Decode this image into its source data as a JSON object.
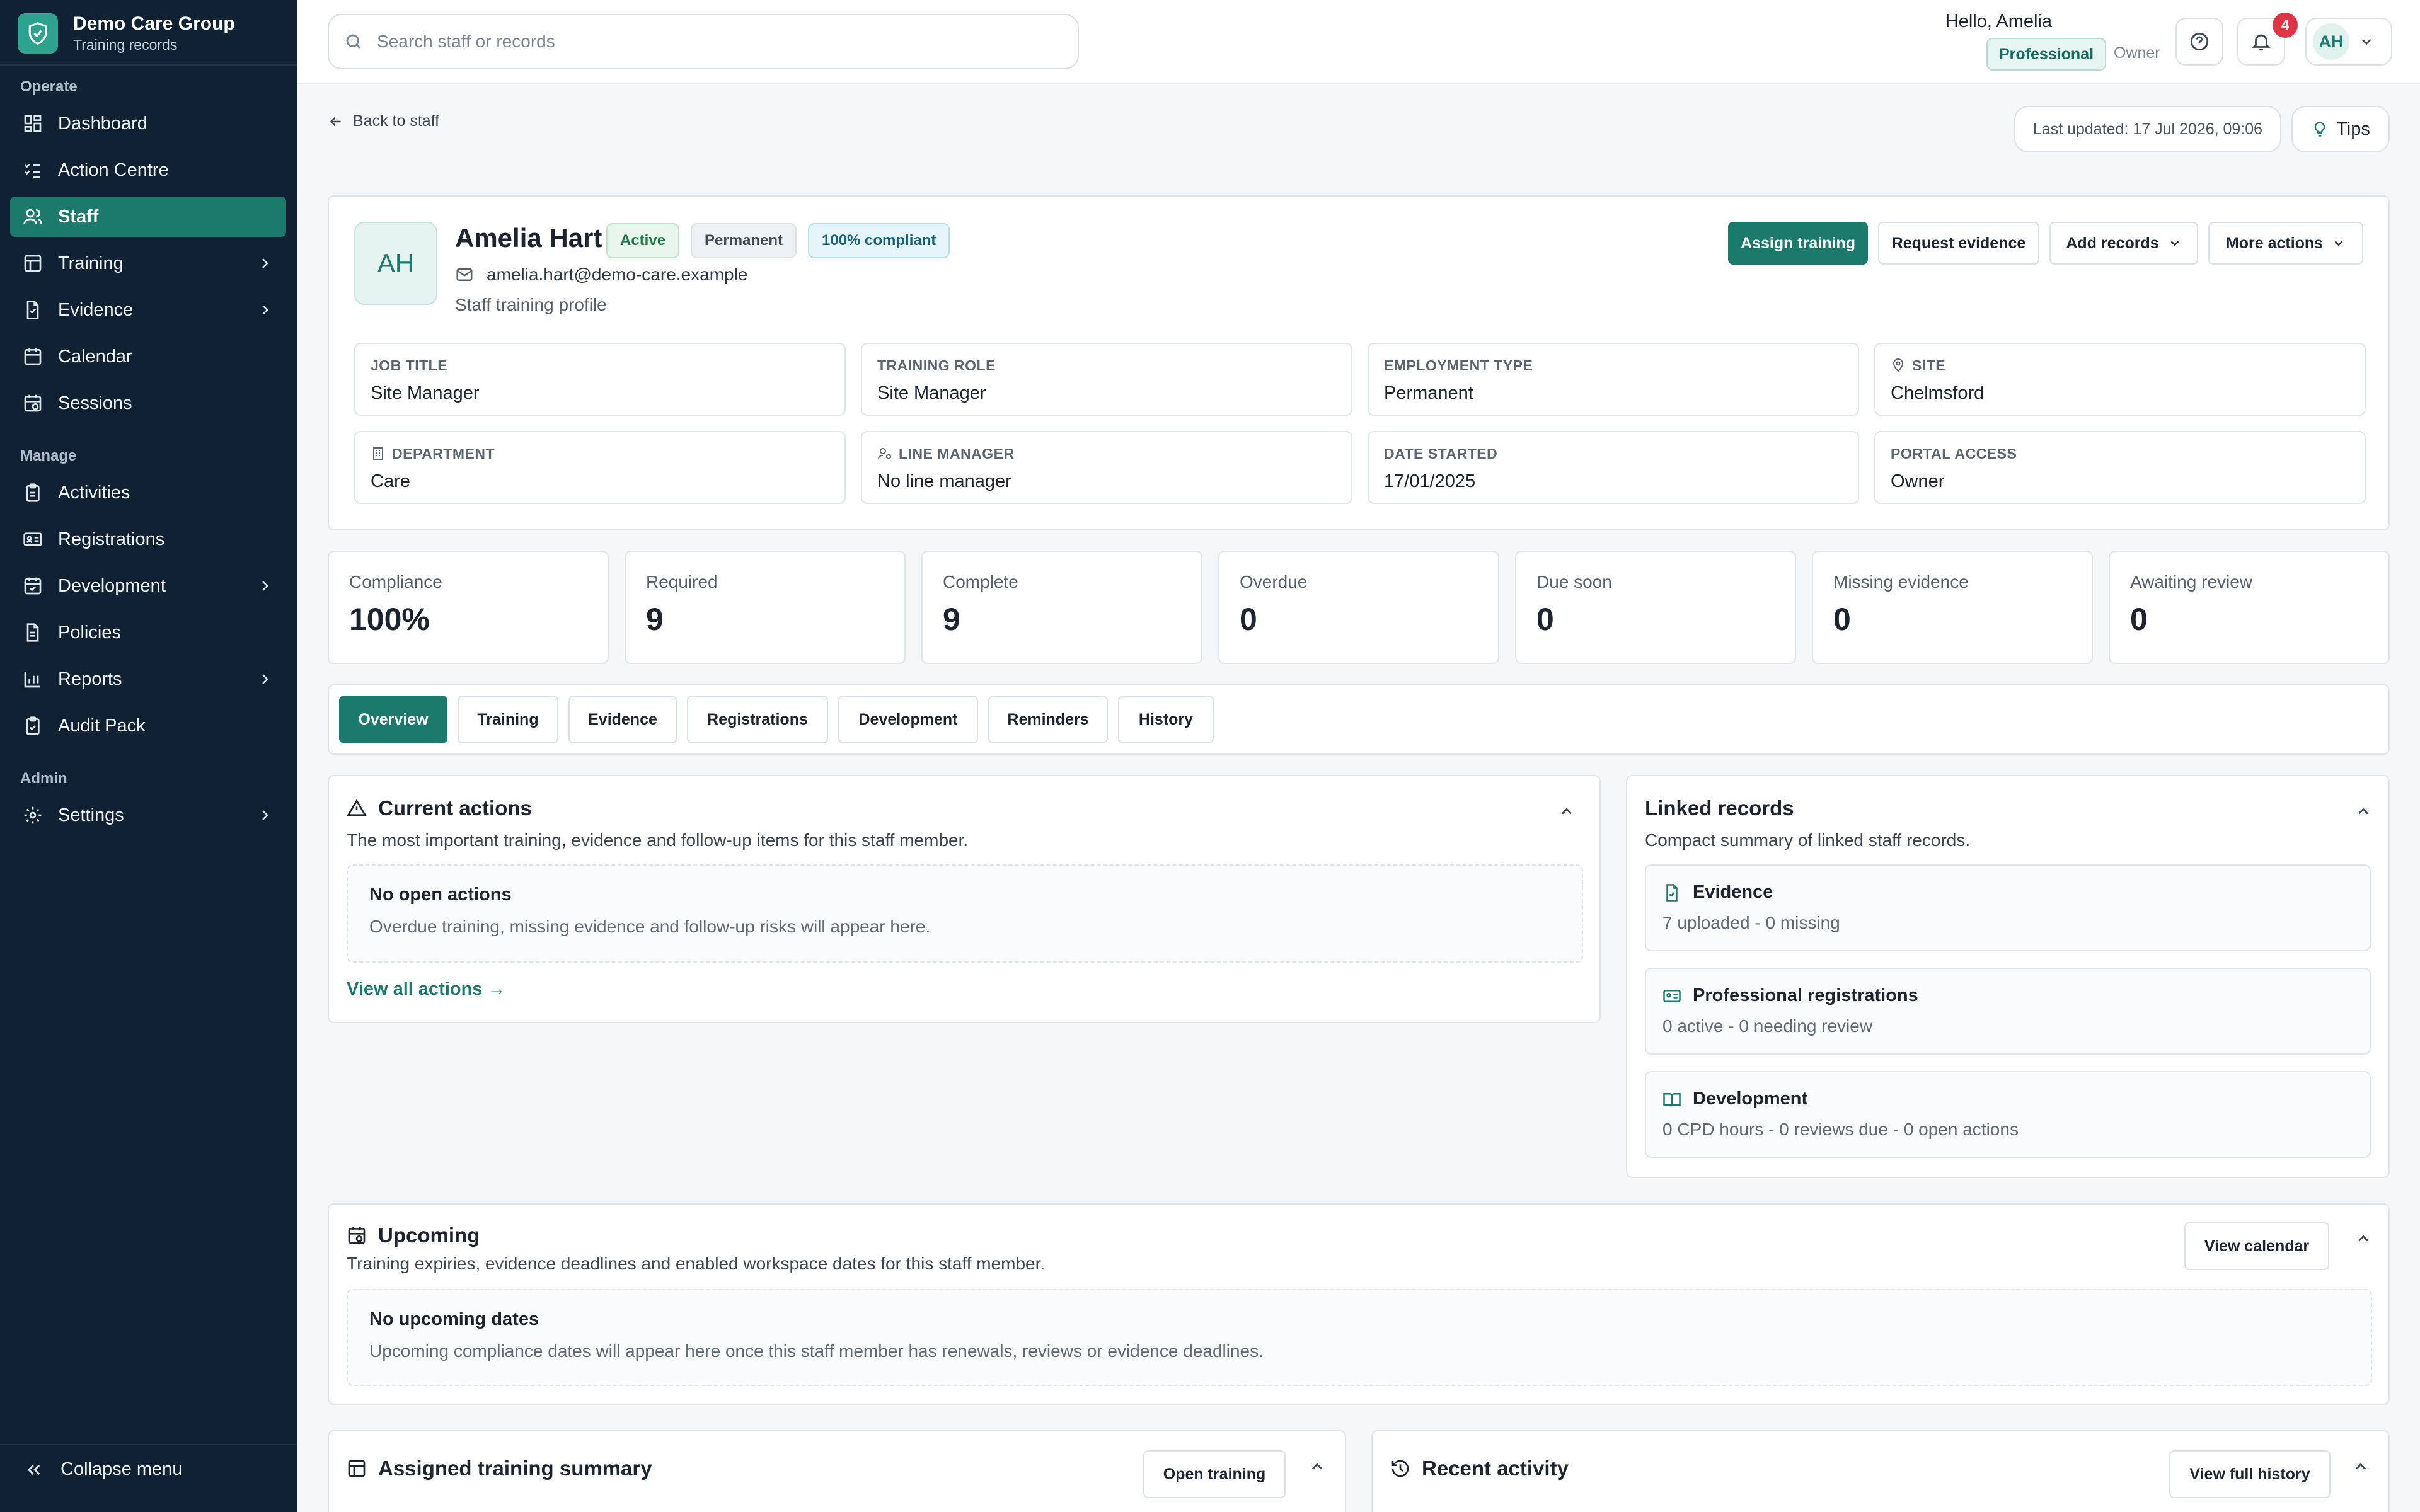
{
  "sidebar": {
    "brand": {
      "name": "Demo Care Group",
      "subtitle": "Training records"
    },
    "sections": [
      {
        "label": "Operate",
        "items": [
          {
            "label": "Dashboard",
            "icon": "dashboard-icon"
          },
          {
            "label": "Action Centre",
            "icon": "list-checks-icon"
          },
          {
            "label": "Staff",
            "icon": "users-icon",
            "active": true
          },
          {
            "label": "Training",
            "icon": "table-icon",
            "expandable": true
          },
          {
            "label": "Evidence",
            "icon": "file-icon",
            "expandable": true
          },
          {
            "label": "Calendar",
            "icon": "calendar-icon"
          },
          {
            "label": "Sessions",
            "icon": "calendar-clock-icon"
          }
        ]
      },
      {
        "label": "Manage",
        "items": [
          {
            "label": "Activities",
            "icon": "clipboard-icon"
          },
          {
            "label": "Registrations",
            "icon": "id-card-icon"
          },
          {
            "label": "Development",
            "icon": "calendar-check-icon",
            "expandable": true
          },
          {
            "label": "Policies",
            "icon": "document-icon"
          },
          {
            "label": "Reports",
            "icon": "bar-chart-icon",
            "expandable": true
          },
          {
            "label": "Audit Pack",
            "icon": "clipboard-check-icon"
          }
        ]
      },
      {
        "label": "Admin",
        "items": [
          {
            "label": "Settings",
            "icon": "gear-icon",
            "expandable": true
          }
        ]
      }
    ],
    "collapse_label": "Collapse menu"
  },
  "topbar": {
    "search_placeholder": "Search staff or records",
    "greeting": "Hello, Amelia",
    "plan": "Professional",
    "role": "Owner",
    "notification_count": "4",
    "avatar_initials": "AH"
  },
  "page": {
    "back_label": "Back to staff",
    "last_updated": "Last updated: 17 Jul 2026, 09:06",
    "tips_label": "Tips"
  },
  "profile": {
    "initials": "AH",
    "name": "Amelia Hart",
    "badges": {
      "status": "Active",
      "type": "Permanent",
      "compliance": "100% compliant"
    },
    "email": "amelia.hart@demo-care.example",
    "subtitle": "Staff training profile",
    "actions": {
      "assign": "Assign training",
      "request": "Request evidence",
      "add": "Add records",
      "more": "More actions"
    },
    "fields": [
      {
        "label": "JOB TITLE",
        "value": "Site Manager"
      },
      {
        "label": "TRAINING ROLE",
        "value": "Site Manager"
      },
      {
        "label": "EMPLOYMENT TYPE",
        "value": "Permanent"
      },
      {
        "label": "SITE",
        "value": "Chelmsford"
      },
      {
        "label": "DEPARTMENT",
        "value": "Care"
      },
      {
        "label": "LINE MANAGER",
        "value": "No line manager"
      },
      {
        "label": "DATE STARTED",
        "value": "17/01/2025"
      },
      {
        "label": "PORTAL ACCESS",
        "value": "Owner"
      }
    ]
  },
  "stats": [
    {
      "label": "Compliance",
      "value": "100%"
    },
    {
      "label": "Required",
      "value": "9"
    },
    {
      "label": "Complete",
      "value": "9"
    },
    {
      "label": "Overdue",
      "value": "0"
    },
    {
      "label": "Due soon",
      "value": "0"
    },
    {
      "label": "Missing evidence",
      "value": "0"
    },
    {
      "label": "Awaiting review",
      "value": "0"
    }
  ],
  "tabs": [
    "Overview",
    "Training",
    "Evidence",
    "Registrations",
    "Development",
    "Reminders",
    "History"
  ],
  "current_actions": {
    "title": "Current actions",
    "description": "The most important training, evidence and follow-up items for this staff member.",
    "empty_title": "No open actions",
    "empty_desc": "Overdue training, missing evidence and follow-up risks will appear here.",
    "link": "View all actions →"
  },
  "linked_records": {
    "title": "Linked records",
    "description": "Compact summary of linked staff records.",
    "items": [
      {
        "title": "Evidence",
        "desc": "7 uploaded - 0 missing"
      },
      {
        "title": "Professional registrations",
        "desc": "0 active - 0 needing review"
      },
      {
        "title": "Development",
        "desc": "0 CPD hours - 0 reviews due - 0 open actions"
      }
    ]
  },
  "upcoming": {
    "title": "Upcoming",
    "description": "Training expiries, evidence deadlines and enabled workspace dates for this staff member.",
    "button": "View calendar",
    "empty_title": "No upcoming dates",
    "empty_desc": "Upcoming compliance dates will appear here once this staff member has renewals, reviews or evidence deadlines."
  },
  "assigned_summary": {
    "title": "Assigned training summary",
    "button": "Open training"
  },
  "recent_activity": {
    "title": "Recent activity",
    "button": "View full history"
  },
  "colors": {
    "sidebar": "#0f2133",
    "accent": "#1c7a6c",
    "brand_logo": "#2da38f",
    "alert": "#dc3545"
  }
}
